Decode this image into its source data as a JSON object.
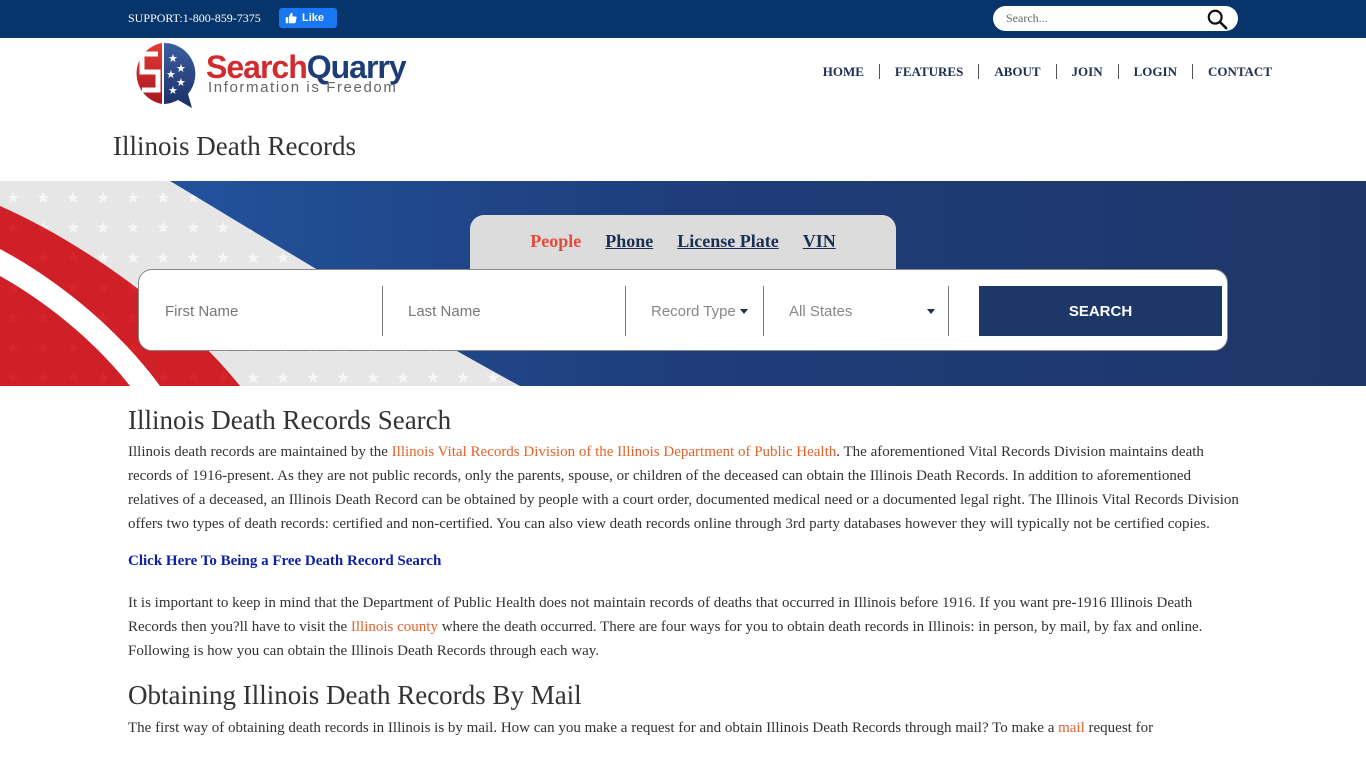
{
  "topbar": {
    "support_text": "SUPPORT:1-800-859-7375",
    "fb_like_label": "Like",
    "search_placeholder": "Search..."
  },
  "logo": {
    "brand_part1": "Search",
    "brand_part2": "Quarry",
    "tagline": "Information is Freedom"
  },
  "nav": {
    "items": [
      {
        "label": "HOME"
      },
      {
        "label": "FEATURES"
      },
      {
        "label": "ABOUT"
      },
      {
        "label": "JOIN"
      },
      {
        "label": "LOGIN"
      },
      {
        "label": "CONTACT"
      }
    ]
  },
  "page_title": "Illinois Death Records",
  "search_tabs": {
    "items": [
      {
        "label": "People",
        "active": true
      },
      {
        "label": "Phone"
      },
      {
        "label": "License Plate"
      },
      {
        "label": "VIN"
      }
    ]
  },
  "search_form": {
    "first_name_placeholder": "First Name",
    "last_name_placeholder": "Last Name",
    "record_type_label": "Record Type",
    "state_label": "All States",
    "search_button": "SEARCH"
  },
  "content": {
    "section1_heading": "Illinois Death Records Search",
    "p1_a": "Illinois death records are maintained by the ",
    "p1_link": "Illinois Vital Records Division of the Illinois Department of Public Health",
    "p1_b": ". The aforementioned Vital Records Division maintains death records of 1916-present. As they are not public records, only the parents, spouse, or children of the deceased can obtain the Illinois Death Records. In addition to aforementioned relatives of a deceased, an Illinois Death Record can be obtained by people with a court order, documented medical need or a documented legal right. The Illinois Vital Records Division offers two types of death records: certified and non-certified. You can also view death records online through 3rd party databases however they will typically not be certified copies.",
    "cta_link": "Click Here To Being a Free Death Record Search",
    "p2_a": "It is important to keep in mind that the Department of Public Health does not maintain records of deaths that occurred in Illinois before 1916. If you want pre-1916 Illinois Death Records then you?ll have to visit the ",
    "p2_link": "Illinois county",
    "p2_b": " where the death occurred. There are four ways for you to obtain death records in Illinois: in person, by mail, by fax and online. Following is how you can obtain the Illinois Death Records through each way.",
    "section2_heading": "Obtaining Illinois Death Records By Mail",
    "p3_a": "The first way of obtaining death records in Illinois is by mail. How can you make a request for and obtain Illinois Death Records through mail? To make a ",
    "p3_link": "mail",
    "p3_b": " request for"
  },
  "colors": {
    "topbar": "#06346b",
    "navy": "#1e3769",
    "brand_red": "#d32a2d",
    "link_orange": "#e2632e",
    "cta_blue": "#0d1fa8",
    "tab_active": "#e24b3b"
  }
}
